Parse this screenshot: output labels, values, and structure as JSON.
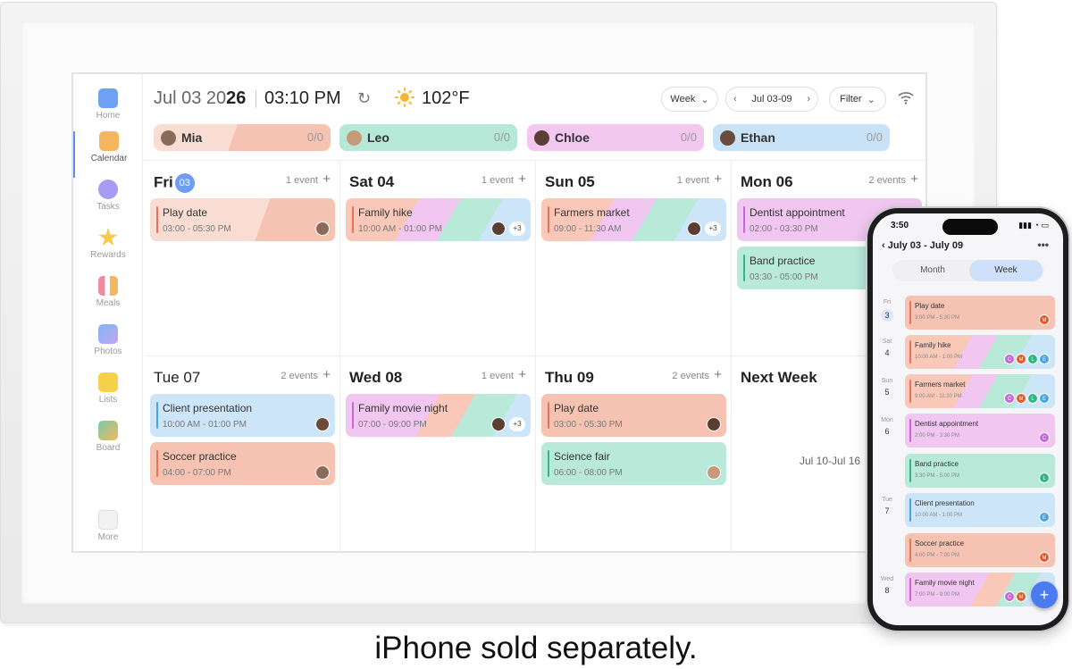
{
  "header": {
    "date_prefix": "Jul 03 20",
    "date_suffix": "26",
    "time": "03:10 PM",
    "temperature": "102°F",
    "view_label": "Week",
    "range_label": "Jul 03-09",
    "filter_label": "Filter"
  },
  "sidebar": {
    "items": [
      {
        "label": "Home",
        "icon": "calendar-check-icon",
        "color": "#6fa0f5"
      },
      {
        "label": "Calendar",
        "icon": "calendar-icon",
        "color": "#f5b660"
      },
      {
        "label": "Tasks",
        "icon": "checkmark-circle-icon",
        "color": "#a79cf5"
      },
      {
        "label": "Rewards",
        "icon": "star-icon",
        "color": "#f7c84a"
      },
      {
        "label": "Meals",
        "icon": "utensils-icon",
        "color": "#f08aa0"
      },
      {
        "label": "Photos",
        "icon": "photo-icon",
        "color": "#7fb6f4"
      },
      {
        "label": "Lists",
        "icon": "list-icon",
        "color": "#f6d14b"
      },
      {
        "label": "Board",
        "icon": "board-icon",
        "color": "#79cba8"
      },
      {
        "label": "More",
        "icon": "grid-icon",
        "color": "#bbbbbb"
      }
    ]
  },
  "members": [
    {
      "name": "Mia",
      "count": "0/0",
      "color": "#f6c3b3"
    },
    {
      "name": "Leo",
      "count": "0/0",
      "color": "#b6e8d8"
    },
    {
      "name": "Chloe",
      "count": "0/0",
      "color": "#f2c8f0"
    },
    {
      "name": "Ethan",
      "count": "0/0",
      "color": "#c8e2f8"
    }
  ],
  "days": [
    {
      "name": "Fri",
      "num": "03",
      "today": true,
      "count": "1 event"
    },
    {
      "name": "Sat",
      "num": "04",
      "count": "1 event"
    },
    {
      "name": "Sun",
      "num": "05",
      "count": "1 event"
    },
    {
      "name": "Mon",
      "num": "06",
      "count": "2 events"
    },
    {
      "name": "Tue",
      "num": "07",
      "count": "2 events"
    },
    {
      "name": "Wed",
      "num": "08",
      "count": "1 event"
    },
    {
      "name": "Thu",
      "num": "09",
      "count": "2 events"
    }
  ],
  "next_week": {
    "title": "Next Week",
    "range": "Jul 10-Jul 16"
  },
  "events": [
    {
      "title": "Play date",
      "time": "03:00 - 05:30 PM"
    },
    {
      "title": "Family hike",
      "time": "10:00 AM - 01:00 PM",
      "more": "+3"
    },
    {
      "title": "Farmers market",
      "time": "09:00 - 11:30 AM",
      "more": "+3"
    },
    {
      "title": "Dentist appointment",
      "time": "02:00 - 03:30 PM"
    },
    {
      "title": "Band practice",
      "time": "03:30 - 05:00 PM"
    },
    {
      "title": "Client presentation",
      "time": "10:00 AM - 01:00 PM"
    },
    {
      "title": "Soccer practice",
      "time": "04:00 - 07:00 PM"
    },
    {
      "title": "Family movie night",
      "time": "07:00 - 09:00 PM",
      "more": "+3"
    },
    {
      "title": "Play date",
      "time": "03:00 - 05:30 PM"
    },
    {
      "title": "Science fair",
      "time": "06:00 - 08:00 PM"
    }
  ],
  "phone": {
    "status_time": "3:50",
    "range": "July 03  -  July 09",
    "more_label": "•••",
    "toggle_month": "Month",
    "toggle_week": "Week",
    "days": [
      {
        "name": "Fri",
        "num": "3"
      },
      {
        "name": "Sat",
        "num": "4"
      },
      {
        "name": "Sun",
        "num": "5"
      },
      {
        "name": "Mon",
        "num": "6"
      },
      {
        "name": "Tue",
        "num": "7"
      },
      {
        "name": "Wed",
        "num": "8"
      }
    ],
    "events": [
      {
        "title": "Play date",
        "time": "3:00 PM - 5:30 PM"
      },
      {
        "title": "Family hike",
        "time": "10:00 AM - 1:00 PM"
      },
      {
        "title": "Farmers market",
        "time": "9:00 AM - 11:30 PM"
      },
      {
        "title": "Dentist appointment",
        "time": "2:00 PM - 3:30 PM"
      },
      {
        "title": "Band practice",
        "time": "3:30 PM - 5:00 PM"
      },
      {
        "title": "Client presentation",
        "time": "10:00 AM - 1:00 PM"
      },
      {
        "title": "Soccer practice",
        "time": "4:00 PM - 7:00 PM"
      },
      {
        "title": "Family movie night",
        "time": "7:00 PM - 9:00 PM"
      }
    ],
    "badges": {
      "c": "C",
      "m": "M",
      "l": "L",
      "e": "E"
    },
    "fab": "+"
  },
  "colors": {
    "salmon": "#f6c3b3",
    "mint": "#b9e9d9",
    "pink": "#f1c6f1",
    "sky": "#cde5f8",
    "accent": "#5b8cf0"
  },
  "caption": "iPhone sold separately."
}
